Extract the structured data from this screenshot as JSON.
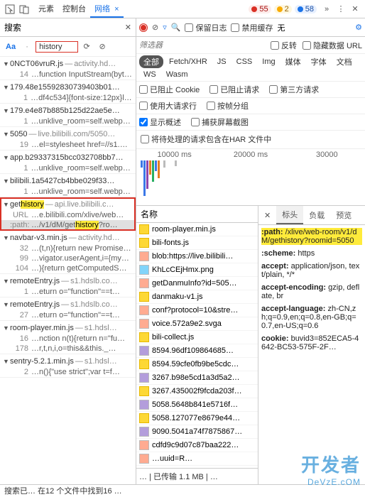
{
  "topbar": {
    "tabs": [
      "元素",
      "控制台",
      "网络"
    ],
    "active_tab": 2,
    "error_count": "55",
    "warn_count": "2",
    "info_count": "58"
  },
  "search": {
    "title": "搜索",
    "query": "history",
    "case_label": "Aa"
  },
  "search_results": [
    {
      "file": "0NCT06vruR.js",
      "loc": "activity.hd…",
      "hits": [
        {
          "ln": "14",
          "txt": "…function InputStream(byt…"
        }
      ]
    },
    {
      "file": "179.48e15592830739403b01…",
      "loc": "",
      "hits": [
        {
          "ln": "1",
          "txt": "…df4c534]{font-size:12px}la…"
        }
      ]
    },
    {
      "file": "179.e4e87b885b125d22ae5e…",
      "loc": "",
      "hits": [
        {
          "ln": "1",
          "txt": "…unklive_room=self.webpa…"
        }
      ]
    },
    {
      "file": "5050",
      "loc": "live.bilibili.com/5050…",
      "hits": [
        {
          "ln": "19",
          "txt": "…el=stylesheet href=//s1.…"
        }
      ]
    },
    {
      "file": "app.b29337315bcc032708bb7…",
      "loc": "",
      "hits": [
        {
          "ln": "1",
          "txt": "…unklive_room=self.webpa…"
        }
      ]
    },
    {
      "file": "bilibili.1a5427cb4bbe029f33…",
      "loc": "",
      "hits": [
        {
          "ln": "1",
          "txt": "…unklive_room=self.webpa…"
        }
      ]
    },
    {
      "file": "gethistory",
      "loc": "api.live.bilibili.c…",
      "selected": true,
      "hits": [
        {
          "ln": "URL",
          "txt": "…e.bilibili.com/xlive/web…"
        },
        {
          "ln": ":path:",
          "txt": "…/v1/dM/gethistory?ro…",
          "hl": "history",
          "selrow": true
        }
      ]
    },
    {
      "file": "navbar-v3.min.js",
      "loc": "activity.hd…",
      "hits": [
        {
          "ln": "32",
          "txt": "…(t,n){return new Promise…"
        },
        {
          "ln": "99",
          "txt": "…vigator.userAgent,i={my…"
        },
        {
          "ln": "104",
          "txt": "…){return getComputedS…"
        }
      ]
    },
    {
      "file": "remoteEntry.js",
      "loc": "s1.hdslb.co…",
      "hits": [
        {
          "ln": "1",
          "txt": "…eturn o=\"function\"==t…"
        }
      ]
    },
    {
      "file": "remoteEntry.js",
      "loc": "s1.hdslb.co…",
      "hits": [
        {
          "ln": "27",
          "txt": "…eturn o=\"function\"==t…"
        }
      ]
    },
    {
      "file": "room-player.min.js",
      "loc": "s1.hdsl…",
      "hits": [
        {
          "ln": "16",
          "txt": "…nction n(t){return n=\"fu…"
        },
        {
          "ln": "178",
          "txt": "…r,t,n,i,o=this&&this._…"
        }
      ]
    },
    {
      "file": "sentry-5.2.1.min.js",
      "loc": "s1.hdsl…",
      "hits": [
        {
          "ln": "2",
          "txt": "…n(){\"use strict\";var t=f…"
        }
      ]
    }
  ],
  "network": {
    "toolbar": {
      "preserve_log": "保留日志",
      "disable_cache": "禁用缓存",
      "throttle": "无"
    },
    "filter": {
      "placeholder": "筛选器",
      "invert": "反转",
      "hide_data_urls": "隐藏数据 URL"
    },
    "types": [
      "全部",
      "Fetch/XHR",
      "JS",
      "CSS",
      "Img",
      "媒体",
      "字体",
      "文档",
      "WS",
      "Wasm"
    ],
    "options": {
      "blocked_cookies": "已阻止 Cookie",
      "blocked_requests": "已阻止请求",
      "third_party": "第三方请求",
      "large_rows": "使用大请求行",
      "group_by_frame": "按帧分组",
      "show_overview": "显示概述",
      "capture_screenshots": "捕获屏幕截图"
    },
    "har_note": "将待处理的请求包含在HAR 文件中",
    "overview_ticks": [
      "10000 ms",
      "20000 ms",
      "30000"
    ],
    "name_header": "名称",
    "requests": [
      {
        "name": "room-player.min.js",
        "type": "js"
      },
      {
        "name": "bili-fonts.js",
        "type": "js"
      },
      {
        "name": "blob:https://live.bilibili…",
        "type": "xhr"
      },
      {
        "name": "KhLcCEjHmx.png",
        "type": "img"
      },
      {
        "name": "getDanmuInfo?id=505…",
        "type": "xhr"
      },
      {
        "name": "danmaku-v1.js",
        "type": "js"
      },
      {
        "name": "conf?protocol=10&stre…",
        "type": "xhr"
      },
      {
        "name": "voice.572a9e2.svga",
        "type": "xhr"
      },
      {
        "name": "bili-collect.js",
        "type": "js"
      },
      {
        "name": "8594.96df109864685…",
        "type": "css"
      },
      {
        "name": "8594.59cfe0fb9be5cdc…",
        "type": "js"
      },
      {
        "name": "3267.b98e5cd1a3d5a2…",
        "type": "css"
      },
      {
        "name": "3267.435002f9fcda203f…",
        "type": "js"
      },
      {
        "name": "5058.5648b841e5716f…",
        "type": "css"
      },
      {
        "name": "5058.127077e8679e44…",
        "type": "js"
      },
      {
        "name": "9090.5041a74f7875867…",
        "type": "css"
      },
      {
        "name": "cdfd9c9d07c87baa222…",
        "type": "xhr"
      },
      {
        "name": "…uuid=R…",
        "type": "xhr"
      }
    ],
    "summary": "…   |   已传输 1.1 MB   |   …",
    "detail": {
      "tabs": [
        "标头",
        "负载",
        "预览"
      ],
      "active_tab": 0,
      "headers": [
        {
          "k": ":path:",
          "v": "/xlive/web-room/v1/dM/gethistory?roomid=5050",
          "hl": true
        },
        {
          "k": ":scheme:",
          "v": "https"
        },
        {
          "k": "accept:",
          "v": "application/json, text/plain, */*"
        },
        {
          "k": "accept-encoding:",
          "v": "gzip, deflate, br"
        },
        {
          "k": "accept-language:",
          "v": "zh-CN,zh;q=0.9,en;q=0.8,en-GB;q=0.7,en-US;q=0.6"
        },
        {
          "k": "cookie:",
          "v": "buvid3=852ECA5-4642-BC53-575F-2F…"
        },
        {
          "k": "",
          "v": ""
        }
      ]
    }
  },
  "statusbar": "搜索已…   在12 个文件中找到16 …",
  "watermark": {
    "cn": "开发者",
    "en": "DeVzE.cOM"
  }
}
